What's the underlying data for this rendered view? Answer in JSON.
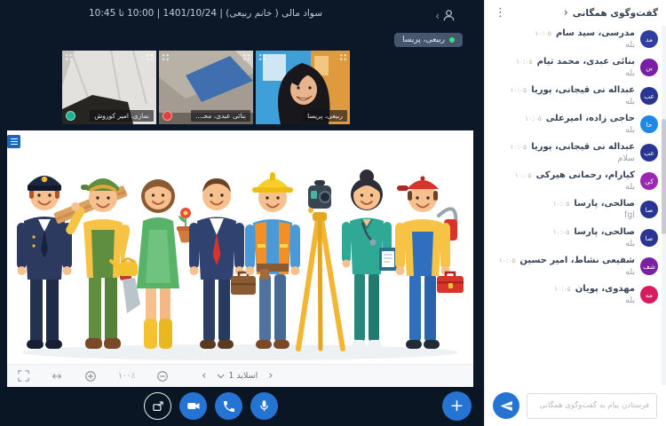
{
  "colors": {
    "main_background": "#0c1828",
    "bottom_bar_background": "#0a1624",
    "accent_blue": "#2574d4",
    "toolbar_background": "#f7f8fa",
    "online_green": "#19b394",
    "muted_red": "#e2403a",
    "speaker_badge_background": "#45566d"
  },
  "icons": {
    "participants": "person-icon",
    "chat_menu": "kebab-icon",
    "send": "paper-plane-icon",
    "actions": [
      "share-screen-icon",
      "camera-icon",
      "phone-icon",
      "microphone-icon",
      "plus-icon"
    ],
    "whiteboard_tools": [
      "fullscreen-icon",
      "fit-width-icon",
      "zoom-in-icon",
      "zoom-out-icon"
    ]
  },
  "top_bar": {
    "title": "سواد مالی ( خانم ربیعی) | 1401/10/24 | 10:00 تا 10:45",
    "participants_chevron": "‹"
  },
  "speaker_badge": {
    "name": "ربیعی، پریسا"
  },
  "videos": [
    {
      "label": "نمازی، امیر کوروش",
      "status": "online"
    },
    {
      "label": "بنائی عبدی، محـ...",
      "status": "muted"
    },
    {
      "label": "ربیعی، پریسا",
      "status": "none"
    }
  ],
  "whiteboard": {
    "zoom_level": "۱۰۰٪",
    "slide_label": "اسلاید 1",
    "prev_chevron": "‹",
    "next_chevron": "›"
  },
  "chat": {
    "title": "گفت‌وگوی همگانی",
    "back_chevron": "‹",
    "menu": "⋮",
    "input_placeholder": "فرستادن پیام به گفت‌وگوی همگانی",
    "messages": [
      {
        "avatar": "مد",
        "name": "مدرسی، سید سام",
        "time": "۱۰:۰۵",
        "text": "بله",
        "color": "#303f9f"
      },
      {
        "avatar": "بن",
        "name": "بنائی عبدی، محمد تیام",
        "time": "۱۰:۰۵",
        "text": "بله",
        "color": "#7b1fa2"
      },
      {
        "avatar": "عب",
        "name": "عبداله نی قیجانی، پوریا",
        "time": "۱۰:۰۵",
        "text": "بله",
        "color": "#283593"
      },
      {
        "avatar": "حا",
        "name": "حاجی زاده، امیرعلی",
        "time": "۱۰:۰۵",
        "text": "بله",
        "color": "#1e88e5"
      },
      {
        "avatar": "عب",
        "name": "عبداله نی قیجانی، پوریا",
        "time": "۱۰:۰۵",
        "text": "سلام",
        "color": "#283593"
      },
      {
        "avatar": "کی",
        "name": "کیارام، رحمانی هیرکی",
        "time": "۱۰:۰۵",
        "text": "بله",
        "color": "#9c27b0"
      },
      {
        "avatar": "صا",
        "name": "صالحی، پارسا",
        "time": "۱۰:۰۵",
        "text": "fgl",
        "color": "#283593"
      },
      {
        "avatar": "صا",
        "name": "صالحی، پارسا",
        "time": "۱۰:۰۵",
        "text": "بله",
        "color": "#283593"
      },
      {
        "avatar": "شف",
        "name": "شفیعی نشاط، امیر حسین",
        "time": "۱۰:۰۵",
        "text": "بله",
        "color": "#7b1fa2"
      },
      {
        "avatar": "مه",
        "name": "مهدوی، پویان",
        "time": "۱۰:۰۵",
        "text": "بله",
        "color": "#d81b60"
      }
    ]
  }
}
